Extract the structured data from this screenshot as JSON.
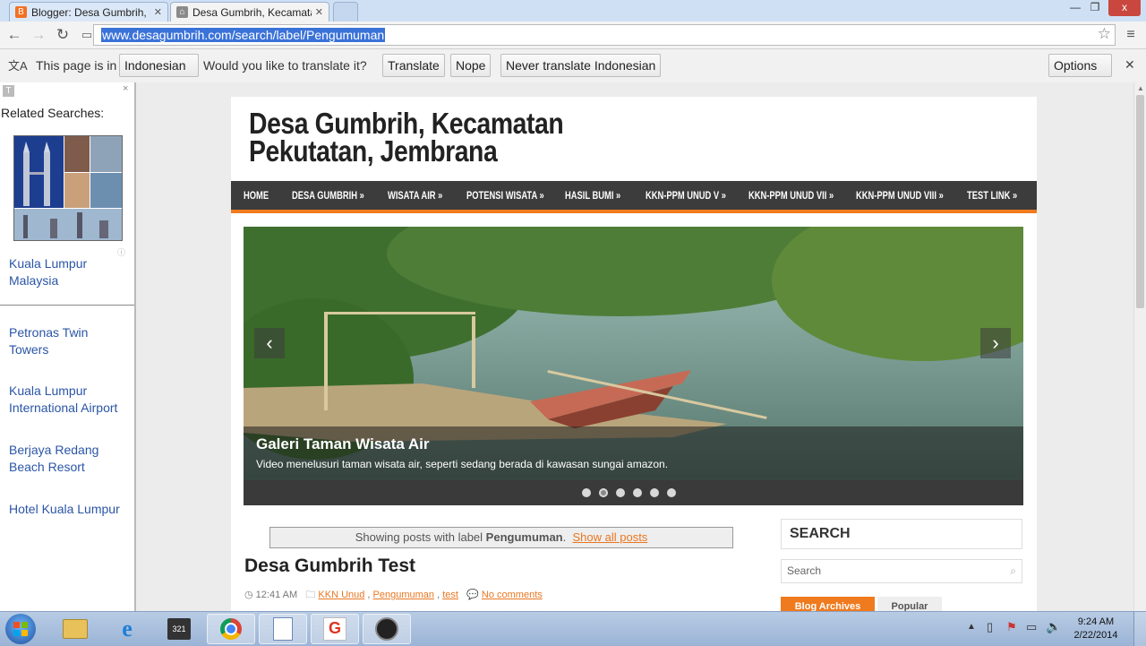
{
  "browser": {
    "tabs": [
      {
        "title": "Blogger: Desa Gumbrih, K",
        "icon": "blogger-icon",
        "icon_letter": "B"
      },
      {
        "title": "Desa Gumbrih, Kecamatan",
        "icon": "site-icon"
      }
    ],
    "url": "www.desagumbrih.com/search/label/Pengumuman",
    "window_controls": {
      "minimize": "—",
      "restore": "❐",
      "close": "x"
    }
  },
  "translate_bar": {
    "prefix": "This page is in",
    "language": "Indonesian",
    "question": "Would you like to translate it?",
    "translate": "Translate",
    "nope": "Nope",
    "never": "Never translate Indonesian",
    "options": "Options"
  },
  "sidebar": {
    "heading": "Related Searches:",
    "links": [
      "Kuala Lumpur Malaysia",
      "Petronas Twin Towers",
      "Kuala Lumpur International Airport",
      "Berjaya Redang Beach Resort",
      "Hotel Kuala Lumpur"
    ]
  },
  "site": {
    "title_line1": "Desa Gumbrih, Kecamatan",
    "title_line2": "Pekutatan, Jembrana",
    "nav": [
      "HOME",
      "DESA GUMBRIH »",
      "WISATA AIR »",
      "POTENSI WISATA »",
      "HASIL BUMI »",
      "KKN-PPM UNUD V »",
      "KKN-PPM UNUD VII »",
      "KKN-PPM UNUD VIII »",
      "TEST LINK »"
    ],
    "slider": {
      "title": "Galeri Taman Wisata Air",
      "text": "Video menelusuri taman wisata air, seperti sedang berada di kawasan sungai amazon.",
      "dot_count": 6,
      "active_dot": 2
    },
    "label_box": {
      "prefix": "Showing posts with label",
      "label": "Pengumuman",
      "show_all": "Show all posts"
    },
    "post": {
      "title": "Desa Gumbrih Test",
      "time": "12:41 AM",
      "labels": [
        "KKN Unud",
        "Pengumuman",
        "test"
      ],
      "comments": "No comments"
    },
    "search": {
      "heading": "SEARCH",
      "placeholder": "Search"
    },
    "tabs": {
      "archives": "Blog Archives",
      "popular": "Popular"
    }
  },
  "taskbar": {
    "time": "9:24 AM",
    "date": "2/22/2014"
  },
  "colors": {
    "accent": "#f07a1e",
    "nav_bg": "#3c3c3c",
    "link": "#2a55a6"
  }
}
